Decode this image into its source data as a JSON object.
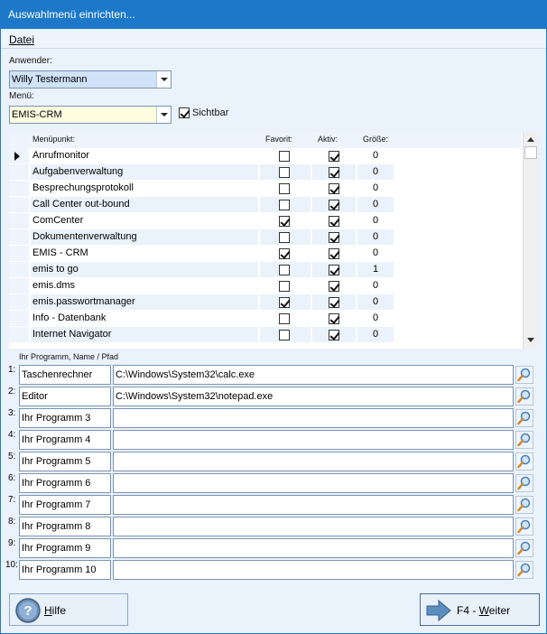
{
  "window": {
    "title": "Auswahlmenü einrichten..."
  },
  "menubar": {
    "file": "Datei"
  },
  "user": {
    "label": "Anwender:",
    "value": "Willy Testermann"
  },
  "menu": {
    "label": "Menü:",
    "value": "EMIS-CRM",
    "visible_label": "Sichtbar",
    "visible_checked": true
  },
  "grid": {
    "headers": {
      "item": "Menüpunkt:",
      "favorite": "Favorit:",
      "active": "Aktiv:",
      "size": "Größe:"
    },
    "rows": [
      {
        "name": "Anrufmonitor",
        "favorite": false,
        "active": true,
        "size": "0",
        "current": true
      },
      {
        "name": "Aufgabenverwaltung",
        "favorite": false,
        "active": true,
        "size": "0"
      },
      {
        "name": "Besprechungsprotokoll",
        "favorite": false,
        "active": true,
        "size": "0"
      },
      {
        "name": "Call Center out-bound",
        "favorite": false,
        "active": true,
        "size": "0"
      },
      {
        "name": "ComCenter",
        "favorite": true,
        "active": true,
        "size": "0"
      },
      {
        "name": "Dokumentenverwaltung",
        "favorite": false,
        "active": true,
        "size": "0"
      },
      {
        "name": "EMIS - CRM",
        "favorite": true,
        "active": true,
        "size": "0"
      },
      {
        "name": "emis to go",
        "favorite": false,
        "active": true,
        "size": "1"
      },
      {
        "name": "emis.dms",
        "favorite": false,
        "active": true,
        "size": "0"
      },
      {
        "name": "emis.passwortmanager",
        "favorite": true,
        "active": true,
        "size": "0"
      },
      {
        "name": "Info - Datenbank",
        "favorite": false,
        "active": true,
        "size": "0"
      },
      {
        "name": "Internet Navigator",
        "favorite": false,
        "active": true,
        "size": "0"
      }
    ]
  },
  "programs": {
    "label": "Ihr Programm, Name / Pfad",
    "rows": [
      {
        "num": "1:",
        "name": "Taschenrechner",
        "path": "C:\\Windows\\System32\\calc.exe"
      },
      {
        "num": "2:",
        "name": "Editor",
        "path": "C:\\Windows\\System32\\notepad.exe"
      },
      {
        "num": "3:",
        "name": "Ihr Programm 3",
        "path": ""
      },
      {
        "num": "4:",
        "name": "Ihr Programm 4",
        "path": ""
      },
      {
        "num": "5:",
        "name": "Ihr Programm 5",
        "path": ""
      },
      {
        "num": "6:",
        "name": "Ihr Programm 6",
        "path": ""
      },
      {
        "num": "7:",
        "name": "Ihr Programm 7",
        "path": ""
      },
      {
        "num": "8:",
        "name": "Ihr Programm 8",
        "path": ""
      },
      {
        "num": "9:",
        "name": "Ihr Programm 9",
        "path": ""
      },
      {
        "num": "10:",
        "name": "Ihr Programm 10",
        "path": ""
      }
    ]
  },
  "buttons": {
    "help": "Hilfe",
    "next": "F4 - Weiter"
  },
  "icons": {
    "help": "help-icon",
    "next": "arrow-right-icon",
    "browse": "magnifier-icon"
  }
}
